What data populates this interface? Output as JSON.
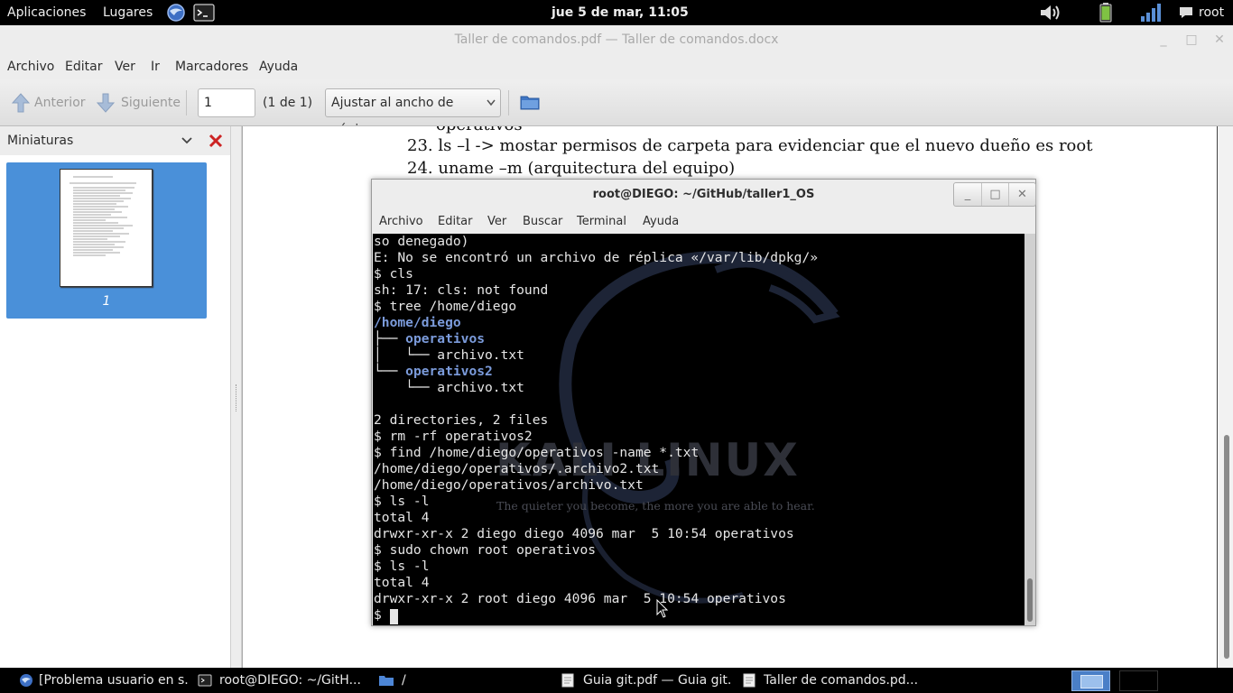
{
  "top_panel": {
    "applications": "Aplicaciones",
    "places": "Lugares",
    "clock": "jue  5 de mar, 11:05",
    "user": "root"
  },
  "evince": {
    "window_title": "Taller de comandos.pdf — Taller de comandos.docx",
    "menu": [
      "Archivo",
      "Editar",
      "Ver",
      "Ir",
      "Marcadores",
      "Ayuda"
    ],
    "toolbar": {
      "prev_label": "Anterior",
      "next_label": "Siguiente",
      "page_value": "1",
      "page_count": "(1 de 1)",
      "zoom_value": "Ajustar al ancho de página"
    },
    "sidebar": {
      "title": "Miniaturas",
      "thumb_label": "1"
    },
    "document_lines": [
      "operativos",
      "23. ls –l -> mostar permisos de carpeta para evidenciar que el nuevo dueño es root",
      "24. uname –m (arquitectura del equipo)"
    ]
  },
  "terminal": {
    "title": "root@DIEGO: ~/GitHub/taller1_OS",
    "menu": [
      "Archivo",
      "Editar",
      "Ver",
      "Buscar",
      "Terminal",
      "Ayuda"
    ],
    "lines": [
      {
        "t": "so denegado)",
        "dir": false
      },
      {
        "t": "E: No se encontró un archivo de réplica «/var/lib/dpkg/»",
        "dir": false
      },
      {
        "t": "$ cls",
        "dir": false
      },
      {
        "t": "sh: 17: cls: not found",
        "dir": false
      },
      {
        "t": "$ tree /home/diego",
        "dir": false
      },
      {
        "t": "/home/diego",
        "dir": true
      },
      {
        "t": "├── ",
        "dir": false,
        "suffix": "operativos"
      },
      {
        "t": "│   └── archivo.txt",
        "dir": false
      },
      {
        "t": "└── ",
        "dir": false,
        "suffix": "operativos2"
      },
      {
        "t": "    └── archivo.txt",
        "dir": false
      },
      {
        "t": "",
        "dir": false
      },
      {
        "t": "2 directories, 2 files",
        "dir": false
      },
      {
        "t": "$ rm -rf operativos2",
        "dir": false
      },
      {
        "t": "$ find /home/diego/operativos -name *.txt",
        "dir": false
      },
      {
        "t": "/home/diego/operativos/.archivo2.txt",
        "dir": false
      },
      {
        "t": "/home/diego/operativos/archivo.txt",
        "dir": false
      },
      {
        "t": "$ ls -l",
        "dir": false
      },
      {
        "t": "total 4",
        "dir": false
      },
      {
        "t": "drwxr-xr-x 2 diego diego 4096 mar  5 10:54 operativos",
        "dir": false
      },
      {
        "t": "$ sudo chown root operativos",
        "dir": false
      },
      {
        "t": "$ ls -l",
        "dir": false
      },
      {
        "t": "total 4",
        "dir": false
      },
      {
        "t": "drwxr-xr-x 2 root diego 4096 mar  5 10:54 operativos",
        "dir": false
      },
      {
        "t": "$ ",
        "dir": false
      }
    ],
    "wallpaper_logo": "KALI LINUX",
    "wallpaper_tagline": "The quieter you become, the more you are able to hear."
  },
  "taskbar": {
    "tasks": [
      "[Problema usuario en s...",
      "root@DIEGO: ~/GitH...",
      "/",
      "Guia git.pdf — Guia git....",
      "Taller de comandos.pd..."
    ]
  },
  "colors": {
    "selection_blue": "#4a90d9",
    "terminal_dir": "#7b9bdb",
    "sidebar_close_red": "#cc2222"
  }
}
